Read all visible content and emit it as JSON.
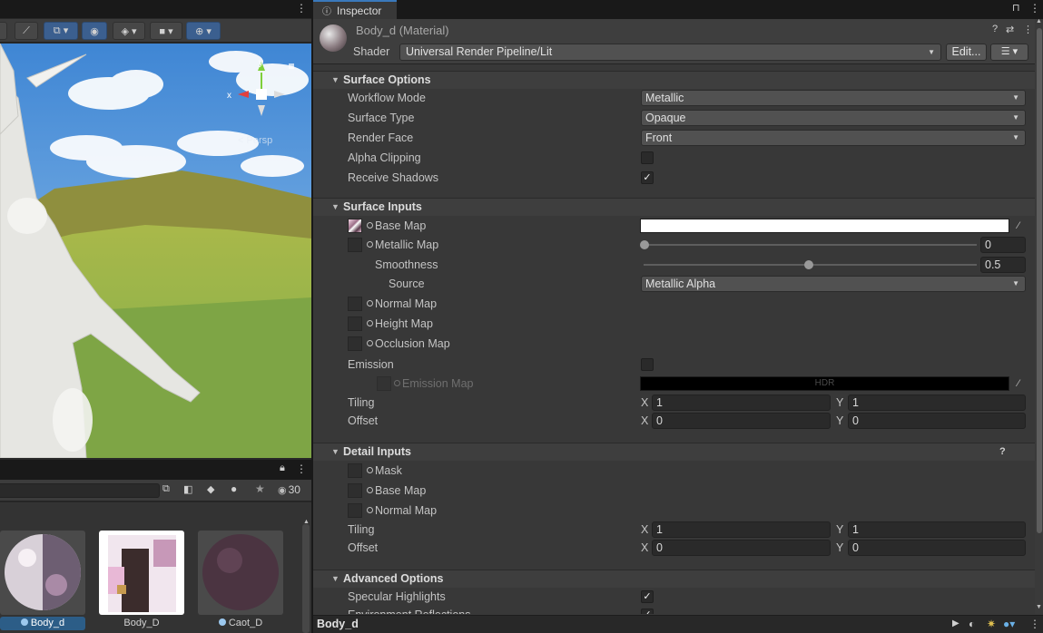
{
  "scene": {
    "viewport_label": "Persp",
    "axis_labels": {
      "x": "x",
      "y": "y"
    }
  },
  "project": {
    "hidden_count": "30",
    "assets": [
      {
        "name": "Body_d",
        "selected": true
      },
      {
        "name": "Body_D",
        "selected": false
      },
      {
        "name": "Caot_D",
        "selected": false
      }
    ]
  },
  "inspector": {
    "tab_label": "Inspector",
    "material_title": "Body_d (Material)",
    "shader_label": "Shader",
    "shader_value": "Universal Render Pipeline/Lit",
    "edit_button": "Edit...",
    "surface_options": {
      "title": "Surface Options",
      "workflow_mode": {
        "label": "Workflow Mode",
        "value": "Metallic"
      },
      "surface_type": {
        "label": "Surface Type",
        "value": "Opaque"
      },
      "render_face": {
        "label": "Render Face",
        "value": "Front"
      },
      "alpha_clipping": {
        "label": "Alpha Clipping",
        "checked": false
      },
      "receive_shadows": {
        "label": "Receive Shadows",
        "checked": true
      }
    },
    "surface_inputs": {
      "title": "Surface Inputs",
      "base_map": {
        "label": "Base Map",
        "color": "#ffffff"
      },
      "metallic_map": {
        "label": "Metallic Map",
        "value": "0",
        "fraction": 0.0
      },
      "smoothness": {
        "label": "Smoothness",
        "value": "0.5",
        "fraction": 0.5
      },
      "source": {
        "label": "Source",
        "value": "Metallic Alpha"
      },
      "normal_map": {
        "label": "Normal Map"
      },
      "height_map": {
        "label": "Height Map"
      },
      "occlusion_map": {
        "label": "Occlusion Map"
      },
      "emission": {
        "label": "Emission",
        "checked": false
      },
      "emission_map": {
        "label": "Emission Map",
        "hdr_text": "HDR",
        "color": "#000000"
      },
      "tiling": {
        "label": "Tiling",
        "x_label": "X",
        "x": "1",
        "y_label": "Y",
        "y": "1"
      },
      "offset": {
        "label": "Offset",
        "x_label": "X",
        "x": "0",
        "y_label": "Y",
        "y": "0"
      }
    },
    "detail_inputs": {
      "title": "Detail Inputs",
      "mask": {
        "label": "Mask"
      },
      "base_map": {
        "label": "Base Map"
      },
      "normal_map": {
        "label": "Normal Map"
      },
      "tiling": {
        "label": "Tiling",
        "x_label": "X",
        "x": "1",
        "y_label": "Y",
        "y": "1"
      },
      "offset": {
        "label": "Offset",
        "x_label": "X",
        "x": "0",
        "y_label": "Y",
        "y": "0"
      }
    },
    "advanced_options": {
      "title": "Advanced Options",
      "specular_highlights": {
        "label": "Specular Highlights",
        "checked": true
      },
      "environment_reflections": {
        "label": "Environment Reflections",
        "checked": true
      }
    },
    "footer_title": "Body_d"
  },
  "colors": {
    "accent_blue": "#3a79bb",
    "selected_bg": "#2c5d87",
    "panel_bg": "#383838"
  }
}
